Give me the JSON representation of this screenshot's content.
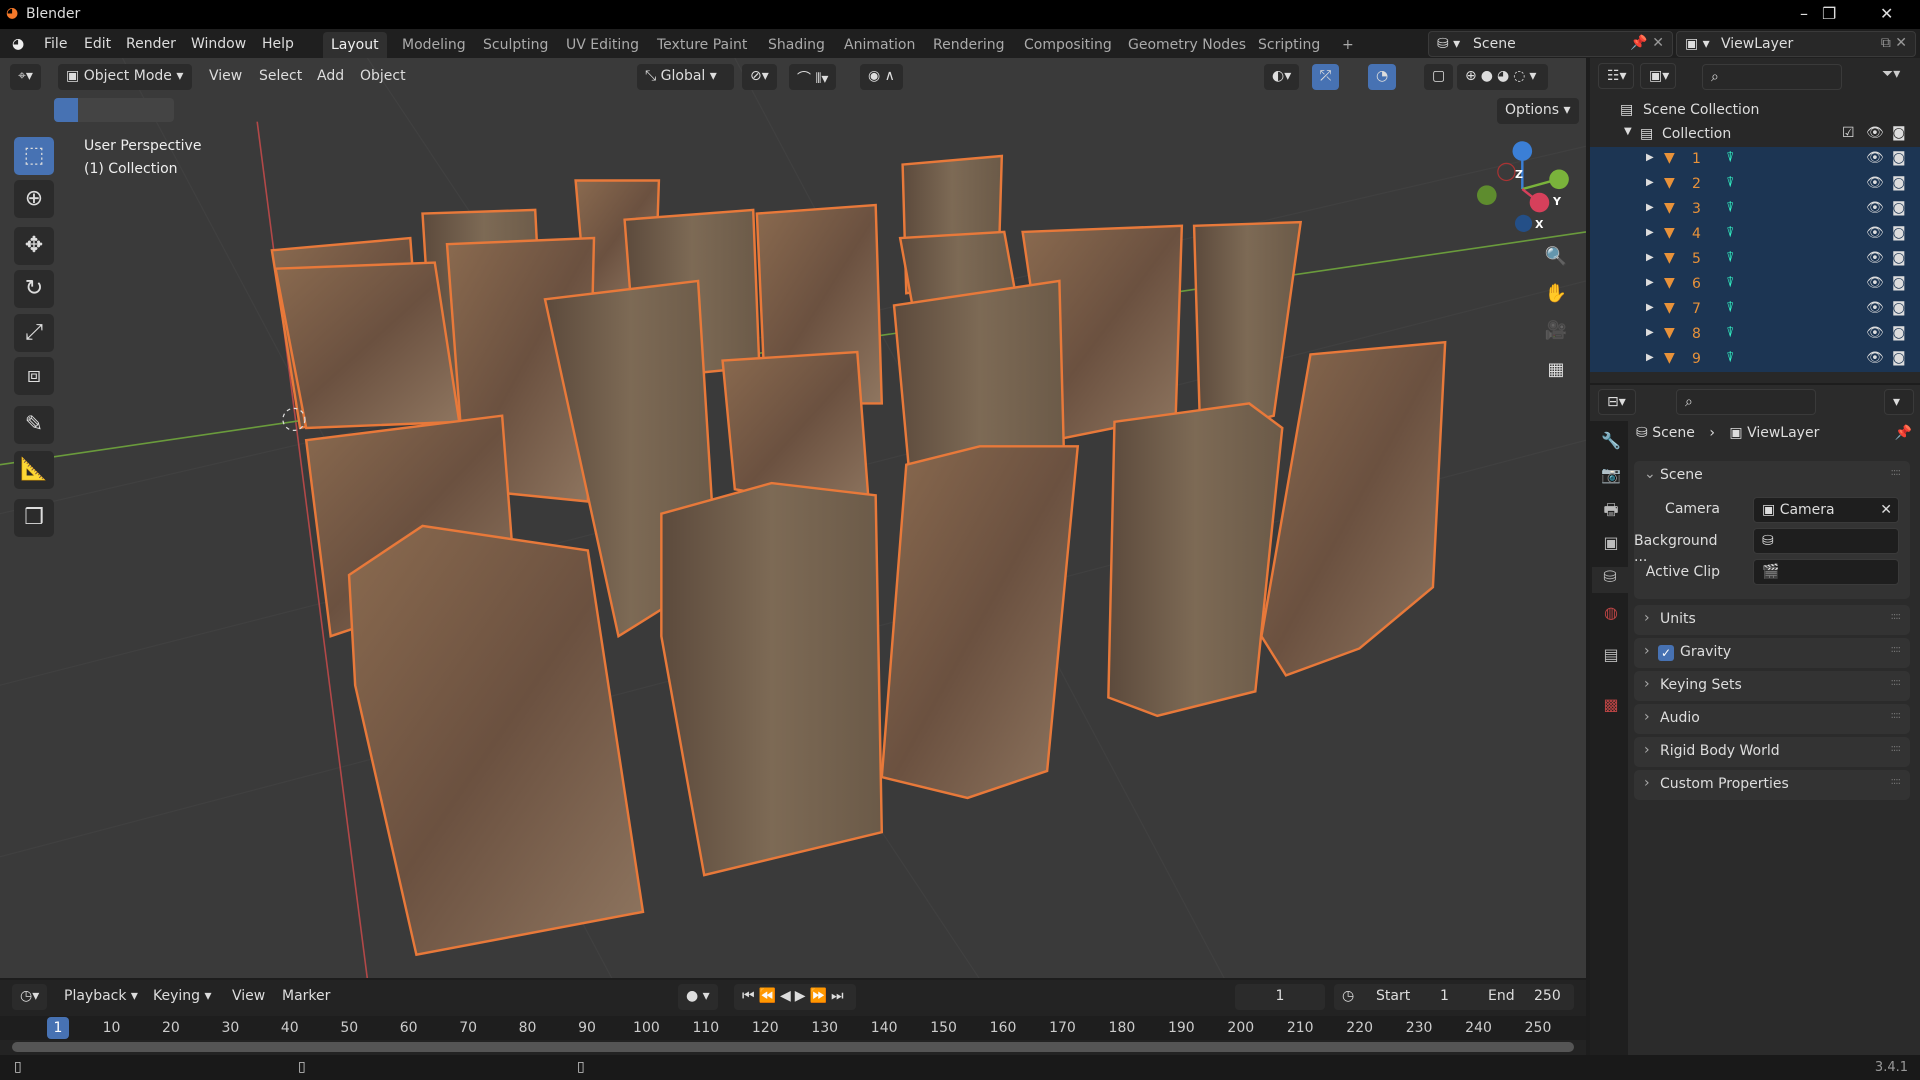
{
  "window": {
    "title": "Blender",
    "controls": [
      "–",
      "❐",
      "✕"
    ]
  },
  "menu": [
    "File",
    "Edit",
    "Render",
    "Window",
    "Help"
  ],
  "workspaces": [
    "Layout",
    "Modeling",
    "Sculpting",
    "UV Editing",
    "Texture Paint",
    "Shading",
    "Animation",
    "Rendering",
    "Compositing",
    "Geometry Nodes",
    "Scripting",
    "+"
  ],
  "scene_selector": {
    "scene": "Scene",
    "view_layer": "ViewLayer"
  },
  "viewport": {
    "mode": "Object Mode",
    "menus": [
      "View",
      "Select",
      "Add",
      "Object"
    ],
    "transform_orientation": "Global",
    "options_label": "Options",
    "overlay_text": {
      "perspective": "User Perspective",
      "collection": "(1) Collection"
    },
    "gizmo_axes": {
      "z": "Z",
      "y": "Y",
      "x": "X"
    },
    "colors": {
      "selection_outline": "#e8793a",
      "active_tool": "#4772b3"
    }
  },
  "outliner": {
    "scene_collection": "Scene Collection",
    "collection": "Collection",
    "objects": [
      "1",
      "2",
      "3",
      "4",
      "5",
      "6",
      "7",
      "8",
      "9"
    ]
  },
  "properties": {
    "breadcrumb": {
      "scene": "Scene",
      "view_layer": "ViewLayer"
    },
    "scene_panel": {
      "title": "Scene",
      "camera_label": "Camera",
      "camera_value": "Camera",
      "background_label": "Background ...",
      "active_clip_label": "Active Clip"
    },
    "panels": [
      {
        "label": "Units",
        "checkbox": false
      },
      {
        "label": "Gravity",
        "checkbox": true
      },
      {
        "label": "Keying Sets",
        "checkbox": false
      },
      {
        "label": "Audio",
        "checkbox": false
      },
      {
        "label": "Rigid Body World",
        "checkbox": false
      },
      {
        "label": "Custom Properties",
        "checkbox": false
      }
    ]
  },
  "timeline": {
    "menus": [
      "Playback",
      "Keying",
      "View",
      "Marker"
    ],
    "current_frame": "1",
    "start_label": "Start",
    "start": "1",
    "end_label": "End",
    "end": "250",
    "ticks": [
      "1",
      "10",
      "20",
      "30",
      "40",
      "50",
      "60",
      "70",
      "80",
      "90",
      "100",
      "110",
      "120",
      "130",
      "140",
      "150",
      "160",
      "170",
      "180",
      "190",
      "200",
      "210",
      "220",
      "230",
      "240",
      "250"
    ]
  },
  "status": {
    "version": "3.4.1"
  }
}
